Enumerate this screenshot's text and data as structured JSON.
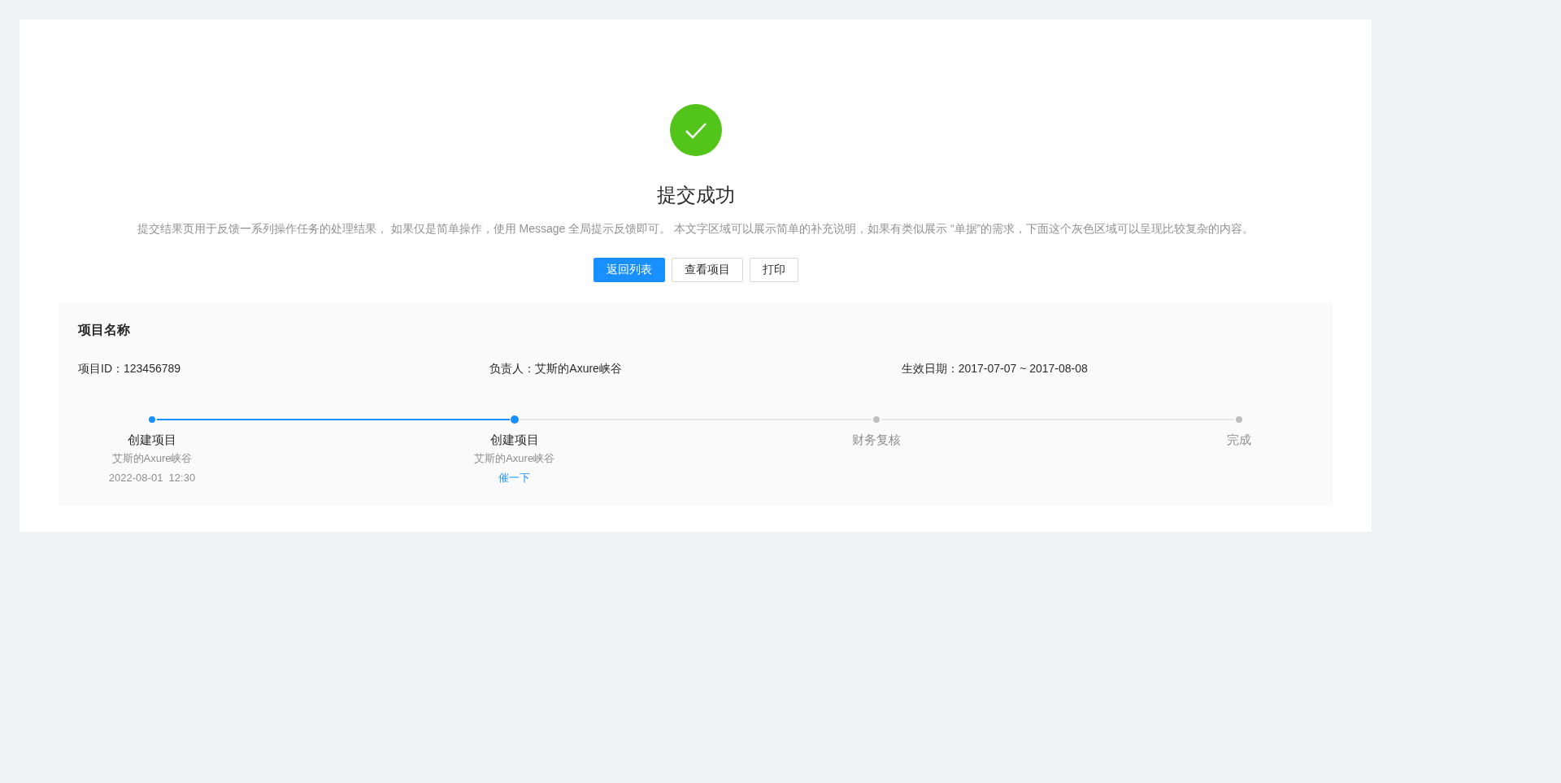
{
  "result": {
    "title": "提交成功",
    "description": "提交结果页用于反馈一系列操作任务的处理结果， 如果仅是简单操作，使用 Message 全局提示反馈即可。 本文字区域可以展示简单的补充说明，如果有类似展示 “单据”的需求，下面这个灰色区域可以呈现比较复杂的内容。"
  },
  "buttons": [
    {
      "label": "返回列表",
      "kind": "primary"
    },
    {
      "label": "查看项目",
      "kind": "default"
    },
    {
      "label": "打印",
      "kind": "default"
    }
  ],
  "project": {
    "title": "项目名称",
    "fields": [
      "项目ID：123456789",
      "负责人：艾斯的Axure峡谷",
      "生效日期：2017-07-07 ~ 2017-08-08"
    ],
    "steps": [
      {
        "title": "创建项目",
        "finished": true,
        "current": false,
        "details": [
          "艾斯的Axure峡谷",
          "2022-08-01  12:30"
        ]
      },
      {
        "title": "创建项目",
        "finished": false,
        "current": true,
        "details": [
          "艾斯的Axure峡谷"
        ],
        "action": "催一下"
      },
      {
        "title": "财务复核",
        "finished": false,
        "current": false
      },
      {
        "title": "完成",
        "finished": false,
        "current": false
      }
    ]
  }
}
